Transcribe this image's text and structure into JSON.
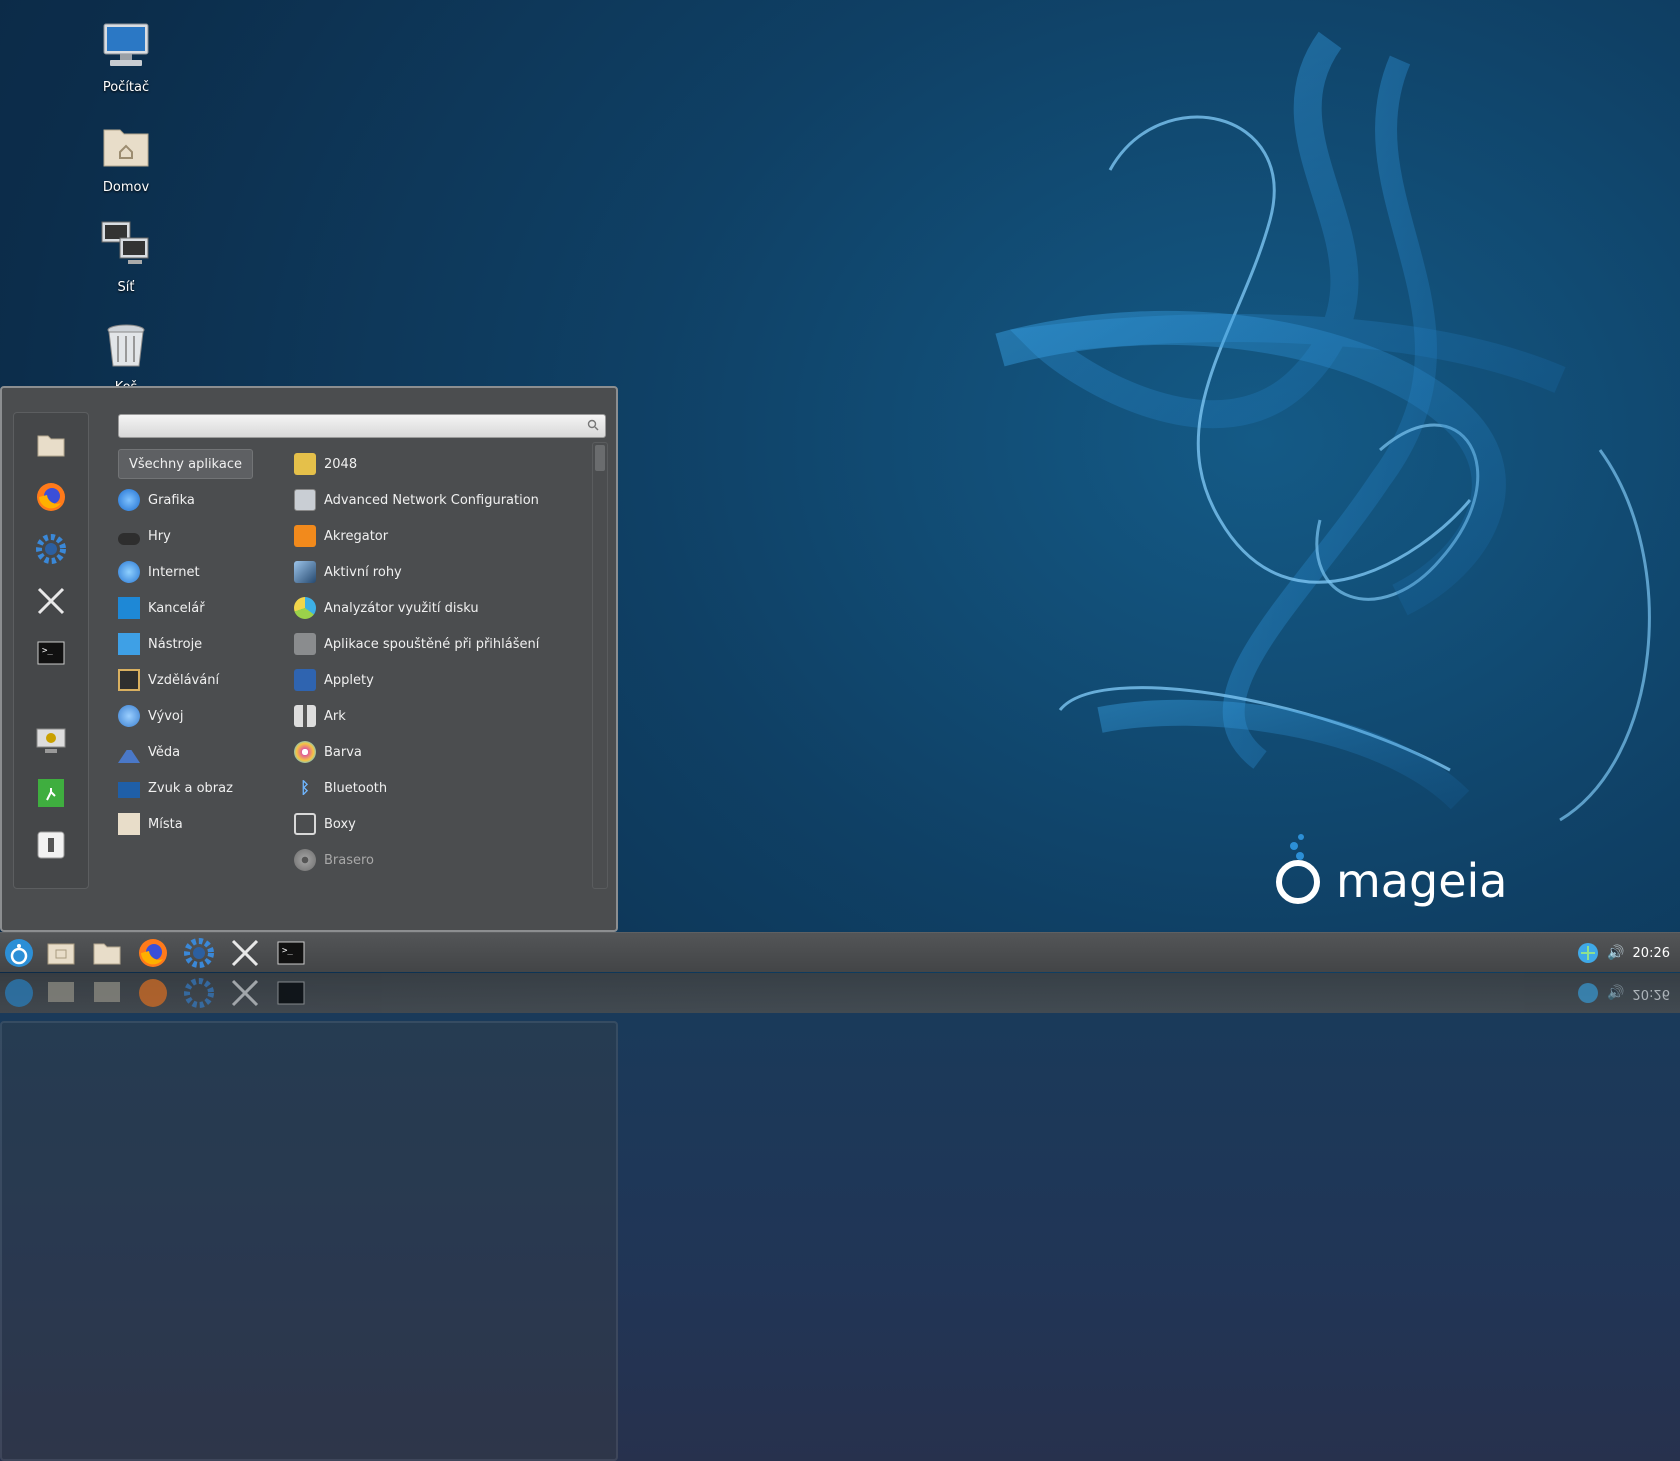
{
  "desktop": {
    "icons": [
      {
        "label": "Počítač",
        "icon": "computer-icon"
      },
      {
        "label": "Domov",
        "icon": "home-folder-icon"
      },
      {
        "label": "Síť",
        "icon": "network-icon"
      },
      {
        "label": "Koš",
        "icon": "trash-icon"
      }
    ],
    "brand": "mageia",
    "colors": {
      "accent": "#2c8fd6",
      "wallpaper": "#0f4065",
      "menu_bg": "#4b4d4f"
    }
  },
  "menu": {
    "search": {
      "value": "",
      "placeholder": ""
    },
    "categories": [
      {
        "label": "Všechny aplikace",
        "selected": true
      },
      {
        "label": "Grafika"
      },
      {
        "label": "Hry"
      },
      {
        "label": "Internet"
      },
      {
        "label": "Kancelář"
      },
      {
        "label": "Nástroje"
      },
      {
        "label": "Vzdělávání"
      },
      {
        "label": "Vývoj"
      },
      {
        "label": "Věda"
      },
      {
        "label": "Zvuk a obraz"
      },
      {
        "label": "Místa"
      }
    ],
    "apps": [
      {
        "label": "2048"
      },
      {
        "label": "Advanced Network Configuration"
      },
      {
        "label": "Akregator"
      },
      {
        "label": "Aktivní rohy"
      },
      {
        "label": "Analyzátor využití disku"
      },
      {
        "label": "Aplikace spouštěné při přihlášení"
      },
      {
        "label": "Applety"
      },
      {
        "label": "Ark"
      },
      {
        "label": "Barva"
      },
      {
        "label": "Bluetooth"
      },
      {
        "label": "Boxy"
      },
      {
        "label": "Brasero"
      }
    ],
    "sidebar": [
      "files-icon",
      "firefox-icon",
      "settings-icon",
      "tools-icon",
      "terminal-icon",
      "lock-screen-icon",
      "logout-icon",
      "shutdown-icon"
    ]
  },
  "panel": {
    "launchers": [
      "menu-icon",
      "file-manager-icon",
      "folder-icon",
      "firefox-icon",
      "settings-icon",
      "tools-icon",
      "terminal-icon"
    ],
    "clock": "20:26",
    "mirrored_clock": "20:26"
  }
}
